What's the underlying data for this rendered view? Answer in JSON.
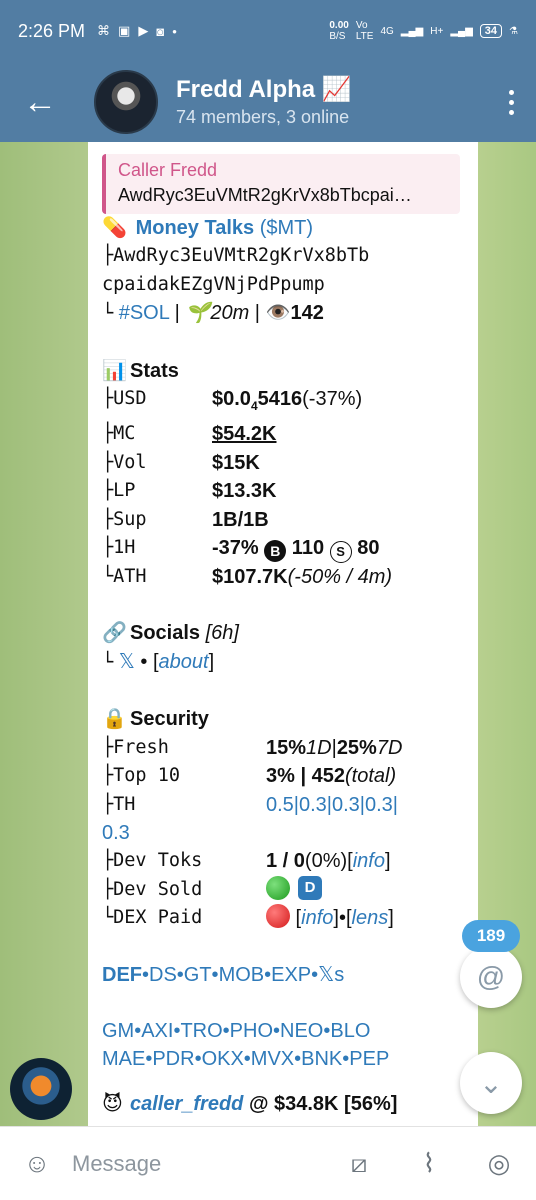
{
  "status": {
    "time": "2:26 PM",
    "net_speed": "0.00",
    "net_unit": "B/S",
    "vo": "Vo",
    "lte": "LTE",
    "g4": "4G",
    "hplus": "H+",
    "battery": "34"
  },
  "header": {
    "title": "Fredd Alpha 📈",
    "subtitle": "74 members, 3 online"
  },
  "message": {
    "reply_name": "Caller Fredd",
    "reply_text": "AwdRyc3EuVMtR2gKrVx8bTbcpai…",
    "token_emoji": "💊",
    "token_name": "Money Talks",
    "token_ticker": "($MT)",
    "address_line1": "├AwdRyc3EuVMtR2gKrVx8bTb",
    "address_line2": "cpaidakEZgVNjPdPpump",
    "chain_prefix": "└",
    "chain": "#SOL",
    "age": "🌱20m",
    "views": "👁️142",
    "stats_title": "Stats",
    "stats_emoji": "📊",
    "stats": {
      "usd_k": "├USD",
      "usd_v": "$0.0",
      "usd_sub": "4",
      "usd_v2": "5416",
      "usd_chg": " (-37%)",
      "mc_k": "├MC",
      "mc_v": "$54.2K",
      "vol_k": "├Vol",
      "vol_v": "$15K",
      "lp_k": "├LP",
      "lp_v": "$13.3K",
      "sup_k": "├Sup",
      "sup_v": "1B/1B",
      "h1_k": "├1H",
      "h1_v": "-37% ",
      "h1_b": "B",
      "h1_bv": " 110 ",
      "h1_s": "S",
      "h1_sv": " 80",
      "ath_k": "└ATH",
      "ath_v": "$107.7K",
      "ath_extra": " (-50% / 4m)"
    },
    "socials_emoji": "🔗",
    "socials_title": "Socials",
    "socials_age": "[6h]",
    "socials_prefix": "└",
    "socials_x": "𝕏",
    "socials_sep": " • ",
    "socials_about_l": "[",
    "socials_about": "about",
    "socials_about_r": "]",
    "security_emoji": "🔒",
    "security_title": "Security",
    "security": {
      "fresh_k": "├Fresh",
      "fresh_v1": "15%",
      "fresh_v1i": " 1D",
      "fresh_sep": " | ",
      "fresh_v2": "25%",
      "fresh_v2i": " 7D",
      "top_k": "├Top 10",
      "top_v": "3% | 452",
      "top_i": " (total)",
      "th_k": "├TH",
      "th_v": "0.5|0.3|0.3|0.3|",
      "th_v2": "0.3",
      "devtoks_k": "├Dev Toks",
      "devtoks_v": "1 / 0",
      "devtoks_p": " (0%)  ",
      "devtoks_info": "info",
      "devsold_k": "├Dev Sold",
      "devsold_d": "D",
      "dexpaid_k": "└DEX Paid",
      "dexpaid_info": "info",
      "dexpaid_lens": "lens",
      "dexpaid_sep": " • "
    },
    "links1": "DEF•DS•GT•MOB•EXP•𝕏s",
    "links1_bold": "DEF",
    "links1_rest": "•DS•GT•MOB•EXP•𝕏s",
    "links2a": "GM•AXI•TRO•PHO•NEO•BLO",
    "links2b": "MAE•PDR•OKX•MVX•BNK•PEP",
    "caller_emoji": "😈",
    "caller_name": "caller_fredd",
    "caller_rest": " @ $34.8K [56%]"
  },
  "fab": {
    "mentions_count": "189",
    "mention_icon": "@",
    "scroll_icon": "⌄"
  },
  "input": {
    "placeholder": "Message",
    "icons": [
      "emoji-icon",
      "command-icon",
      "attach-icon",
      "camera-icon"
    ]
  },
  "colors": {
    "header": "#527da3",
    "link": "#2f7ab9",
    "reply_accent": "#d0568a",
    "badge": "#4aa3df"
  }
}
